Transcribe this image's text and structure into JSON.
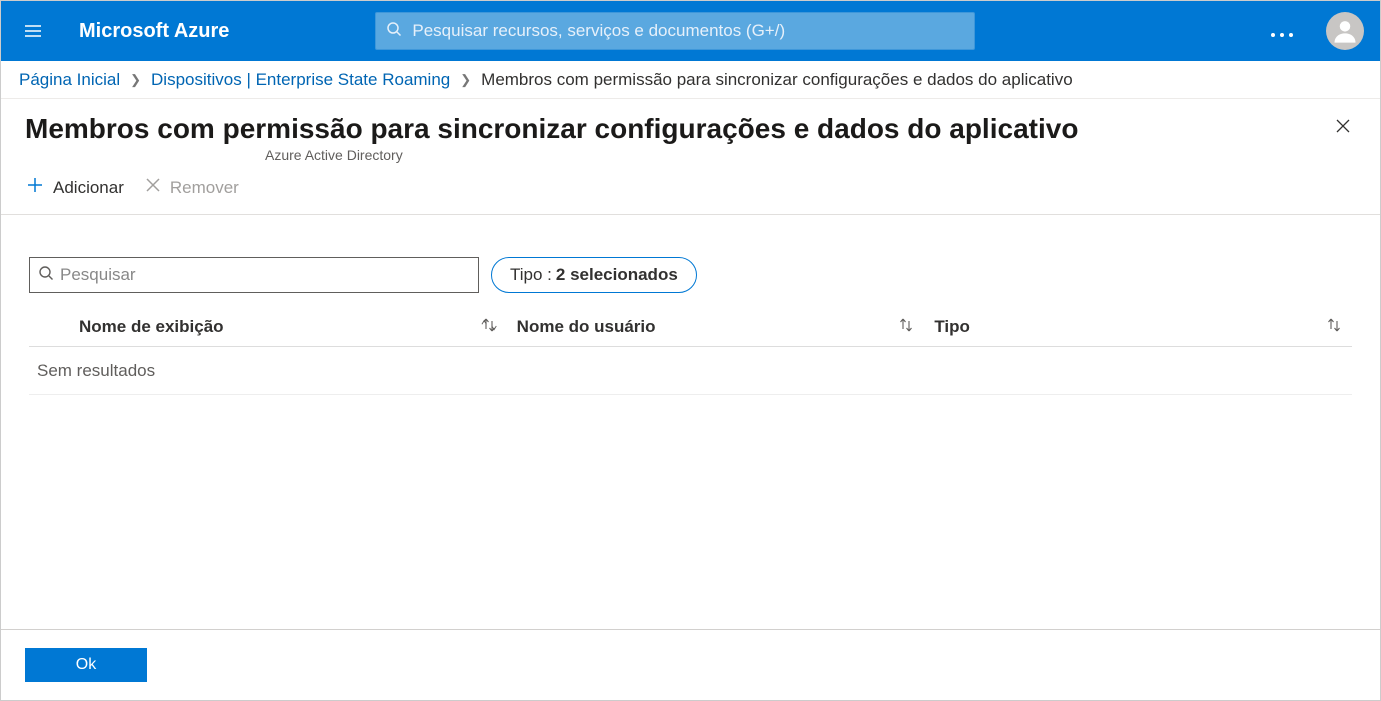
{
  "header": {
    "brand": "Microsoft Azure",
    "search_placeholder": "Pesquisar recursos, serviços e documentos (G+/)"
  },
  "breadcrumb": {
    "items": [
      {
        "label": "Página Inicial",
        "link": true
      },
      {
        "label": "Dispositivos | Enterprise State Roaming",
        "link": true
      },
      {
        "label": "Membros com permissão para sincronizar configurações e dados do aplicativo",
        "link": false
      }
    ]
  },
  "page": {
    "title": "Membros com permissão para sincronizar configurações e dados do aplicativo",
    "subtitle": "Azure Active Directory"
  },
  "toolbar": {
    "add_label": "Adicionar",
    "remove_label": "Remover"
  },
  "filters": {
    "search_placeholder": "Pesquisar",
    "search_value": "",
    "type_pill_prefix": "Tipo : ",
    "type_pill_value": "2 selecionados"
  },
  "table": {
    "columns": {
      "display_name": "Nome de exibição",
      "user_name": "Nome do usuário",
      "type": "Tipo"
    },
    "empty_text": "Sem resultados",
    "rows": []
  },
  "footer": {
    "ok_label": "Ok"
  }
}
